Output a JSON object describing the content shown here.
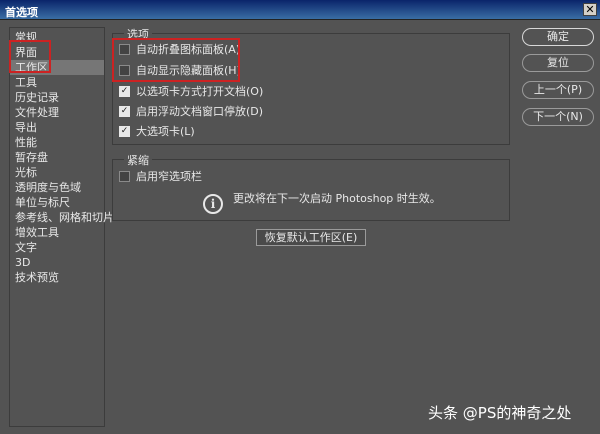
{
  "window": {
    "title": "首选项",
    "close_glyph": "✕"
  },
  "sidebar": {
    "items": [
      {
        "label": "常规",
        "selected": false
      },
      {
        "label": "界面",
        "selected": false
      },
      {
        "label": "工作区",
        "selected": true
      },
      {
        "label": "工具",
        "selected": false
      },
      {
        "label": "历史记录",
        "selected": false
      },
      {
        "label": "文件处理",
        "selected": false
      },
      {
        "label": "导出",
        "selected": false
      },
      {
        "label": "性能",
        "selected": false
      },
      {
        "label": "暂存盘",
        "selected": false
      },
      {
        "label": "光标",
        "selected": false
      },
      {
        "label": "透明度与色域",
        "selected": false
      },
      {
        "label": "单位与标尺",
        "selected": false
      },
      {
        "label": "参考线、网格和切片",
        "selected": false
      },
      {
        "label": "增效工具",
        "selected": false
      },
      {
        "label": "文字",
        "selected": false
      },
      {
        "label": "3D",
        "selected": false
      },
      {
        "label": "技术预览",
        "selected": false
      }
    ]
  },
  "options_group": {
    "title": "选项",
    "checkboxes": [
      {
        "label": "自动折叠图标面板(A)",
        "checked": false
      },
      {
        "label": "自动显示隐藏面板(H)",
        "checked": false
      },
      {
        "label": "以选项卡方式打开文档(O)",
        "checked": true
      },
      {
        "label": "启用浮动文档窗口停放(D)",
        "checked": true
      },
      {
        "label": "大选项卡(L)",
        "checked": true
      }
    ]
  },
  "compact_group": {
    "title": "紧缩",
    "checkbox": {
      "label": "启用窄选项栏",
      "checked": false
    },
    "info_icon": "info-icon",
    "info_text": "更改将在下一次启动 Photoshop 时生效。"
  },
  "restore_button": "恢复默认工作区(E)",
  "buttons": {
    "ok": "确定",
    "reset": "复位",
    "prev": "上一个(P)",
    "next": "下一个(N)"
  },
  "watermark": "头条 @PS的神奇之处",
  "colors": {
    "background": "#535353",
    "selected": "#767676",
    "highlight_red": "#cc2222",
    "titlebar": "#0a246a"
  }
}
